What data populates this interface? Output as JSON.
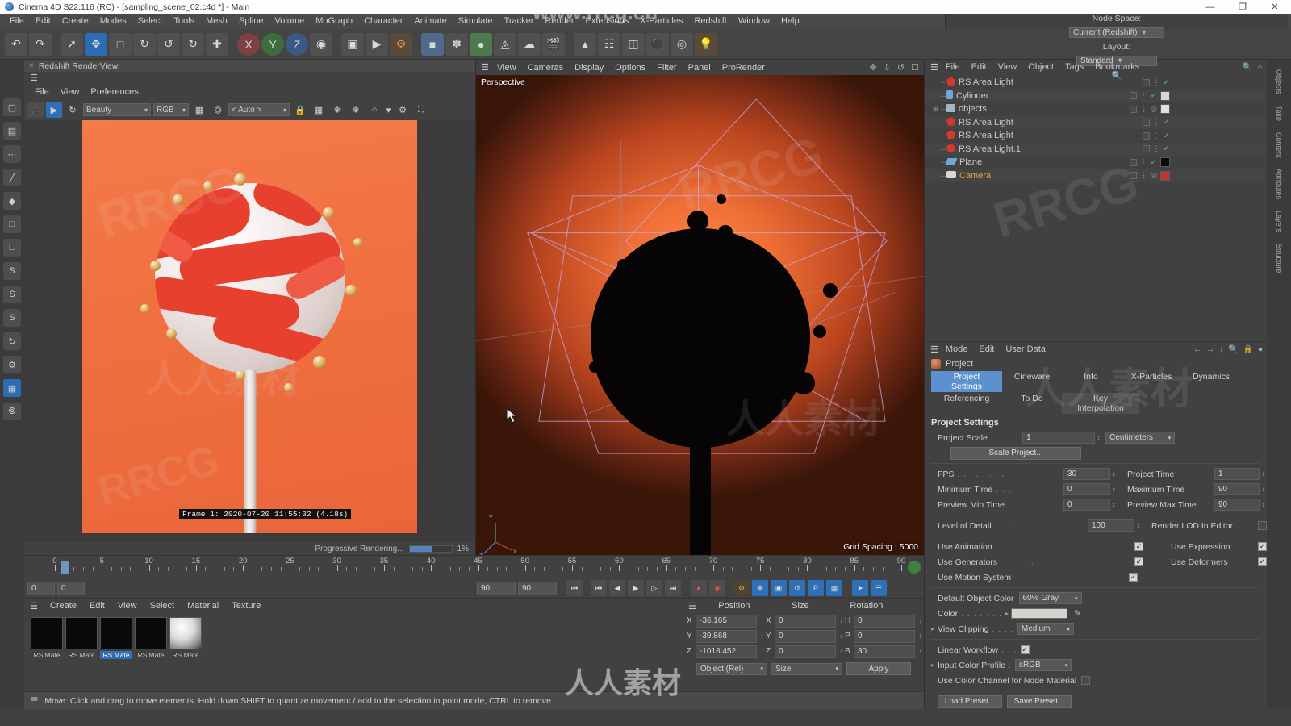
{
  "window": {
    "title": "Cinema 4D S22.116 (RC) - [sampling_scene_02.c4d *] - Main",
    "minimize": "—",
    "maximize": "❐",
    "close": "✕"
  },
  "menubar": {
    "items": [
      "File",
      "Edit",
      "Create",
      "Modes",
      "Select",
      "Tools",
      "Mesh",
      "Spline",
      "Volume",
      "MoGraph",
      "Character",
      "Animate",
      "Simulate",
      "Tracker",
      "Render",
      "Extensions",
      "X-Particles",
      "Redshift",
      "Window",
      "Help"
    ],
    "node_space_label": "Node Space:",
    "node_space_value": "Current (Redshift)",
    "layout_label": "Layout:",
    "layout_value": "Standard"
  },
  "renderview": {
    "tab_title": "Redshift RenderView",
    "close_glyph": "×",
    "menu": [
      "File",
      "View",
      "Preferences"
    ],
    "pass_value": "Beauty",
    "channel_value": "RGB",
    "ratio_value": "< Auto >",
    "frame_info": "Frame  1: 2020-07-20  11:55:32  (4.18s)",
    "progress_label": "Progressive Rendering...",
    "progress_value": "1%",
    "progress_percent": 55
  },
  "viewport": {
    "menu": [
      "View",
      "Cameras",
      "Display",
      "Options",
      "Filter",
      "Panel",
      "ProRender"
    ],
    "label": "Perspective",
    "grid_spacing": "Grid Spacing : 5000"
  },
  "timeline": {
    "ticks": [
      0,
      5,
      10,
      15,
      20,
      25,
      30,
      35,
      40,
      45,
      50,
      55,
      60,
      65,
      70,
      75,
      80,
      85,
      90
    ],
    "min": 0,
    "max": 90,
    "current_frame": 1,
    "field_left": "0",
    "field_left2": "0",
    "start_field": "90",
    "end_field": "90"
  },
  "materials": {
    "menu": [
      "Create",
      "Edit",
      "View",
      "Select",
      "Material",
      "Texture"
    ],
    "items": [
      {
        "label": "RS Mate",
        "selected": false,
        "type": "dark"
      },
      {
        "label": "RS Mate",
        "selected": false,
        "type": "dark"
      },
      {
        "label": "RS Mate",
        "selected": true,
        "type": "dark"
      },
      {
        "label": "RS Mate",
        "selected": false,
        "type": "dark"
      },
      {
        "label": "RS Mate",
        "selected": false,
        "type": "sphere"
      }
    ]
  },
  "coordinates": {
    "headers": [
      "Position",
      "Size",
      "Rotation"
    ],
    "rows": [
      {
        "axis": "X",
        "position": "-36.165",
        "size_axis": "X",
        "size": "0",
        "rot_axis": "H",
        "rotation": "0"
      },
      {
        "axis": "Y",
        "position": "-39.868",
        "size_axis": "Y",
        "size": "0",
        "rot_axis": "P",
        "rotation": "0"
      },
      {
        "axis": "Z",
        "position": "-1018.452",
        "size_axis": "Z",
        "size": "0",
        "rot_axis": "B",
        "rotation": "30"
      }
    ],
    "mode_value": "Object (Rel)",
    "size_value": "Size",
    "apply_label": "Apply"
  },
  "statusbar": {
    "text": "Move: Click and drag to move elements. Hold down SHIFT to quantize movement / add to the selection in point mode, CTRL to remove."
  },
  "object_manager": {
    "menu": [
      "File",
      "Edit",
      "View",
      "Object",
      "Tags",
      "Bookmarks"
    ],
    "objects": [
      {
        "name": "RS Area Light",
        "type": "light",
        "selected": false,
        "visible": true,
        "has_tag": false,
        "tag_color": ""
      },
      {
        "name": "Cylinder",
        "type": "cylinder",
        "selected": false,
        "visible": true,
        "has_tag": true,
        "tag_color": "#d7d7d7"
      },
      {
        "name": "objects",
        "type": "group",
        "selected": false,
        "visible": false,
        "has_tag": true,
        "tag_color": "#e0e0e0"
      },
      {
        "name": "RS Area Light",
        "type": "light",
        "selected": false,
        "visible": true,
        "has_tag": false,
        "tag_color": ""
      },
      {
        "name": "RS Area Light",
        "type": "light",
        "selected": false,
        "visible": true,
        "has_tag": false,
        "tag_color": ""
      },
      {
        "name": "RS Area Light.1",
        "type": "light",
        "selected": false,
        "visible": true,
        "has_tag": false,
        "tag_color": ""
      },
      {
        "name": "Plane",
        "type": "plane",
        "selected": false,
        "visible": true,
        "has_tag": true,
        "tag_color": "#0a0a0a"
      },
      {
        "name": "Camera",
        "type": "camera",
        "selected": true,
        "visible": false,
        "has_tag": true,
        "tag_color": "#c4362c"
      }
    ]
  },
  "attributes": {
    "menu": [
      "Mode",
      "Edit",
      "User Data"
    ],
    "object_name": "Project",
    "tabs_row1": [
      "Project Settings",
      "Cineware",
      "Info",
      "X-Particles",
      "Dynamics"
    ],
    "tabs_row2": [
      "Referencing",
      "To Do",
      "Key Interpolation"
    ],
    "selected_tab": "Project Settings",
    "section_title": "Project Settings",
    "project_scale_label": "Project Scale",
    "project_scale_value": "1",
    "project_scale_unit": "Centimeters",
    "scale_project_button": "Scale Project...",
    "fps_label": "FPS",
    "fps_value": "30",
    "project_time_label": "Project Time",
    "project_time_value": "1",
    "min_time_label": "Minimum Time",
    "min_time_value": "0",
    "max_time_label": "Maximum Time",
    "max_time_value": "90",
    "prev_min_label": "Preview Min Time",
    "prev_min_value": "0",
    "prev_max_label": "Preview Max Time",
    "prev_max_value": "90",
    "lod_label": "Level of Detail",
    "lod_value": "100",
    "render_lod_label": "Render LOD In Editor",
    "render_lod_checked": false,
    "use_animation_label": "Use Animation",
    "use_animation_checked": true,
    "use_expression_label": "Use Expression",
    "use_expression_checked": true,
    "use_generators_label": "Use Generators",
    "use_generators_checked": true,
    "use_deformers_label": "Use Deformers",
    "use_deformers_checked": true,
    "use_motion_label": "Use Motion System",
    "use_motion_checked": true,
    "default_color_label": "Default Object Color",
    "default_color_value": "60% Gray",
    "color_label": "Color",
    "color_swatch": "#d6d2cd",
    "view_clipping_label": "View Clipping",
    "view_clipping_value": "Medium",
    "linear_workflow_label": "Linear Workflow",
    "linear_workflow_checked": true,
    "input_profile_label": "Input Color Profile",
    "input_profile_value": "sRGB",
    "color_channel_label": "Use Color Channel for Node Material",
    "color_channel_checked": false,
    "load_preset": "Load Preset...",
    "save_preset": "Save Preset..."
  },
  "right_rail": [
    "Objects",
    "Take",
    "Content",
    "Attributes",
    "Layers",
    "Structure"
  ],
  "watermarks": [
    "RRCG",
    "www.rrcg.cn",
    "人人素材"
  ]
}
